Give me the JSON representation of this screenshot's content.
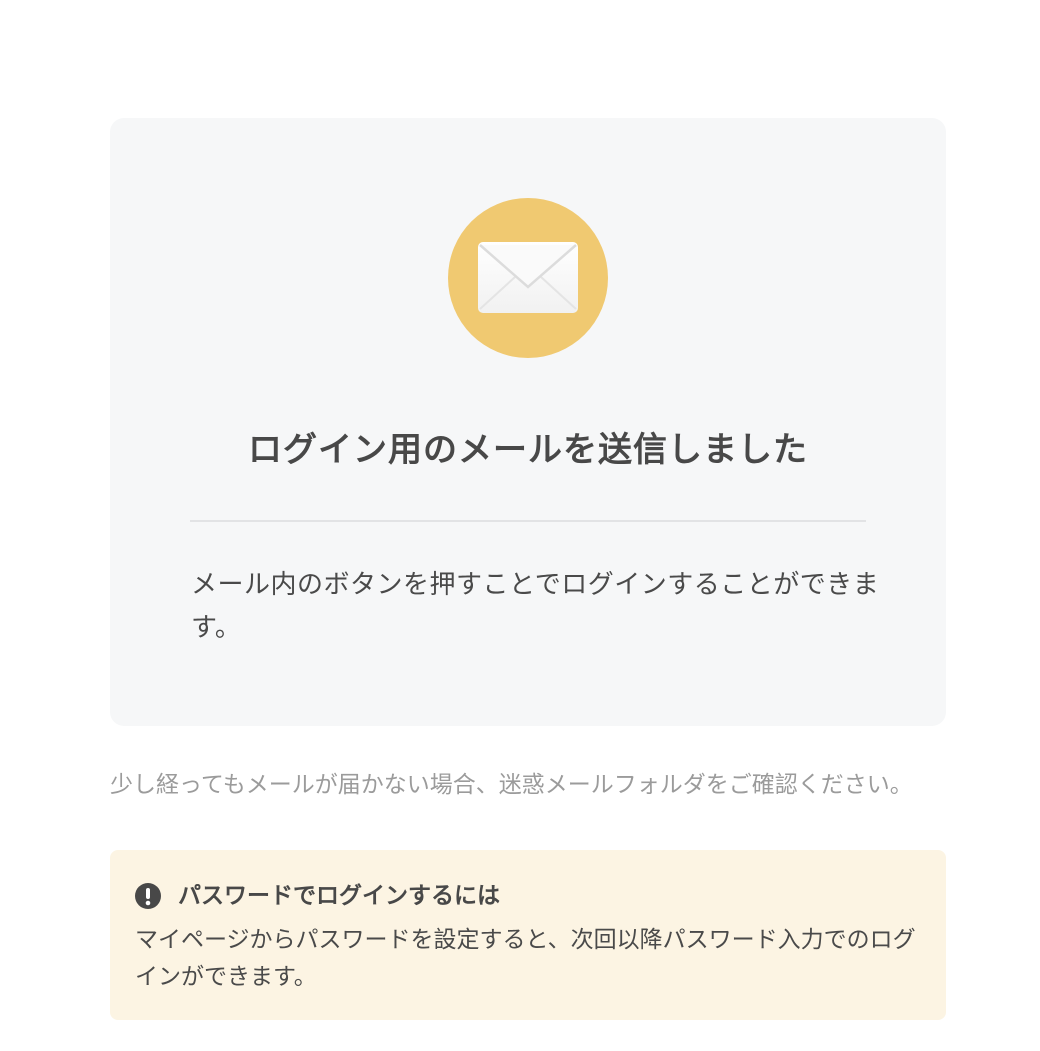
{
  "card": {
    "icon": "envelope-icon",
    "icon_color": "#f0c971",
    "title": "ログイン用のメールを送信しました",
    "body": "メール内のボタンを押すことでログインすることができます。"
  },
  "hint": "少し経ってもメールが届かない場合、迷惑メールフォルダをご確認ください。",
  "notice": {
    "icon": "exclamation-circle-icon",
    "title": "パスワードでログインするには",
    "body": "マイページからパスワードを設定すると、次回以降パスワード入力でのログインができます。",
    "background": "#fcf4e3"
  }
}
